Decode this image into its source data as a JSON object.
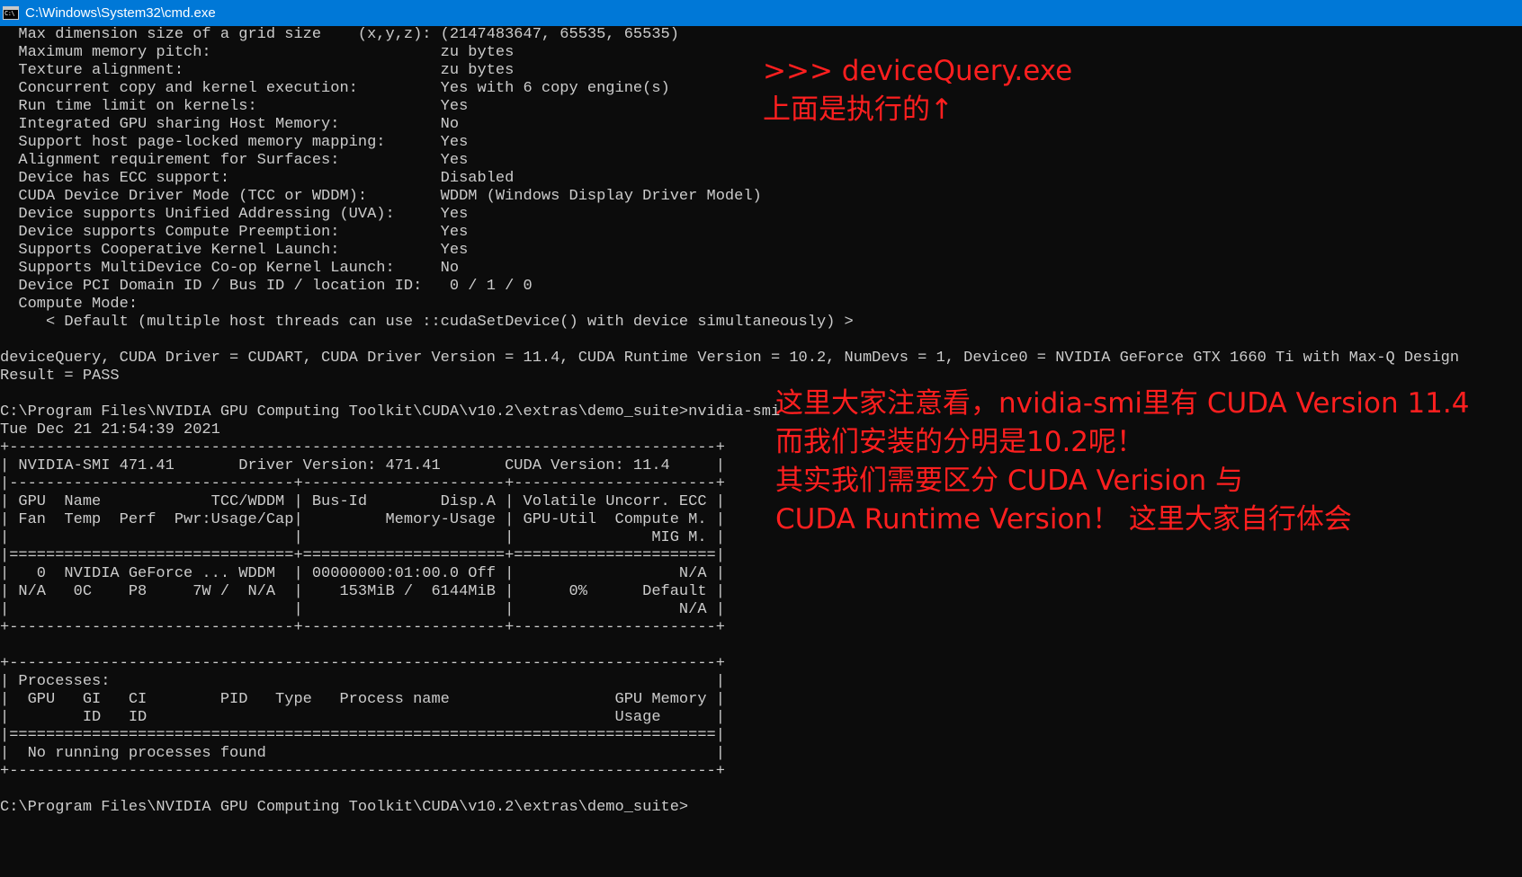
{
  "window": {
    "title": "C:\\Windows\\System32\\cmd.exe",
    "icon_text": "C:\\"
  },
  "console_lines": [
    "  Max dimension size of a grid size    (x,y,z): (2147483647, 65535, 65535)",
    "  Maximum memory pitch:                         zu bytes",
    "  Texture alignment:                            zu bytes",
    "  Concurrent copy and kernel execution:         Yes with 6 copy engine(s)",
    "  Run time limit on kernels:                    Yes",
    "  Integrated GPU sharing Host Memory:           No",
    "  Support host page-locked memory mapping:      Yes",
    "  Alignment requirement for Surfaces:           Yes",
    "  Device has ECC support:                       Disabled",
    "  CUDA Device Driver Mode (TCC or WDDM):        WDDM (Windows Display Driver Model)",
    "  Device supports Unified Addressing (UVA):     Yes",
    "  Device supports Compute Preemption:           Yes",
    "  Supports Cooperative Kernel Launch:           Yes",
    "  Supports MultiDevice Co-op Kernel Launch:     No",
    "  Device PCI Domain ID / Bus ID / location ID:   0 / 1 / 0",
    "  Compute Mode:",
    "     < Default (multiple host threads can use ::cudaSetDevice() with device simultaneously) >",
    "",
    "deviceQuery, CUDA Driver = CUDART, CUDA Driver Version = 11.4, CUDA Runtime Version = 10.2, NumDevs = 1, Device0 = NVIDIA GeForce GTX 1660 Ti with Max-Q Design",
    "Result = PASS",
    "",
    "C:\\Program Files\\NVIDIA GPU Computing Toolkit\\CUDA\\v10.2\\extras\\demo_suite>nvidia-smi",
    "Tue Dec 21 21:54:39 2021",
    "+-----------------------------------------------------------------------------+",
    "| NVIDIA-SMI 471.41       Driver Version: 471.41       CUDA Version: 11.4     |",
    "|-------------------------------+----------------------+----------------------+",
    "| GPU  Name            TCC/WDDM | Bus-Id        Disp.A | Volatile Uncorr. ECC |",
    "| Fan  Temp  Perf  Pwr:Usage/Cap|         Memory-Usage | GPU-Util  Compute M. |",
    "|                               |                      |               MIG M. |",
    "|===============================+======================+======================|",
    "|   0  NVIDIA GeForce ... WDDM  | 00000000:01:00.0 Off |                  N/A |",
    "| N/A   0C    P8     7W /  N/A  |    153MiB /  6144MiB |      0%      Default |",
    "|                               |                      |                  N/A |",
    "+-------------------------------+----------------------+----------------------+",
    "",
    "+-----------------------------------------------------------------------------+",
    "| Processes:                                                                  |",
    "|  GPU   GI   CI        PID   Type   Process name                  GPU Memory |",
    "|        ID   ID                                                   Usage      |",
    "|=============================================================================|",
    "|  No running processes found                                                 |",
    "+-----------------------------------------------------------------------------+",
    "",
    "C:\\Program Files\\NVIDIA GPU Computing Toolkit\\CUDA\\v10.2\\extras\\demo_suite>"
  ],
  "annotations": {
    "top": {
      "line1": ">>> deviceQuery.exe",
      "line2": "上面是执行的↑"
    },
    "middle": {
      "line1": "这里大家注意看，nvidia-smi里有 CUDA Version 11.4",
      "line2": "而我们安装的分明是10.2呢！",
      "line3": "其实我们需要区分 CUDA Verision 与",
      "line4": "CUDA Runtime Version！  这里大家自行体会"
    },
    "color": "#ff1f1f"
  },
  "colors": {
    "titlebar": "#0078d7",
    "console_bg": "#0c0c0c",
    "console_text": "#cccccc"
  }
}
